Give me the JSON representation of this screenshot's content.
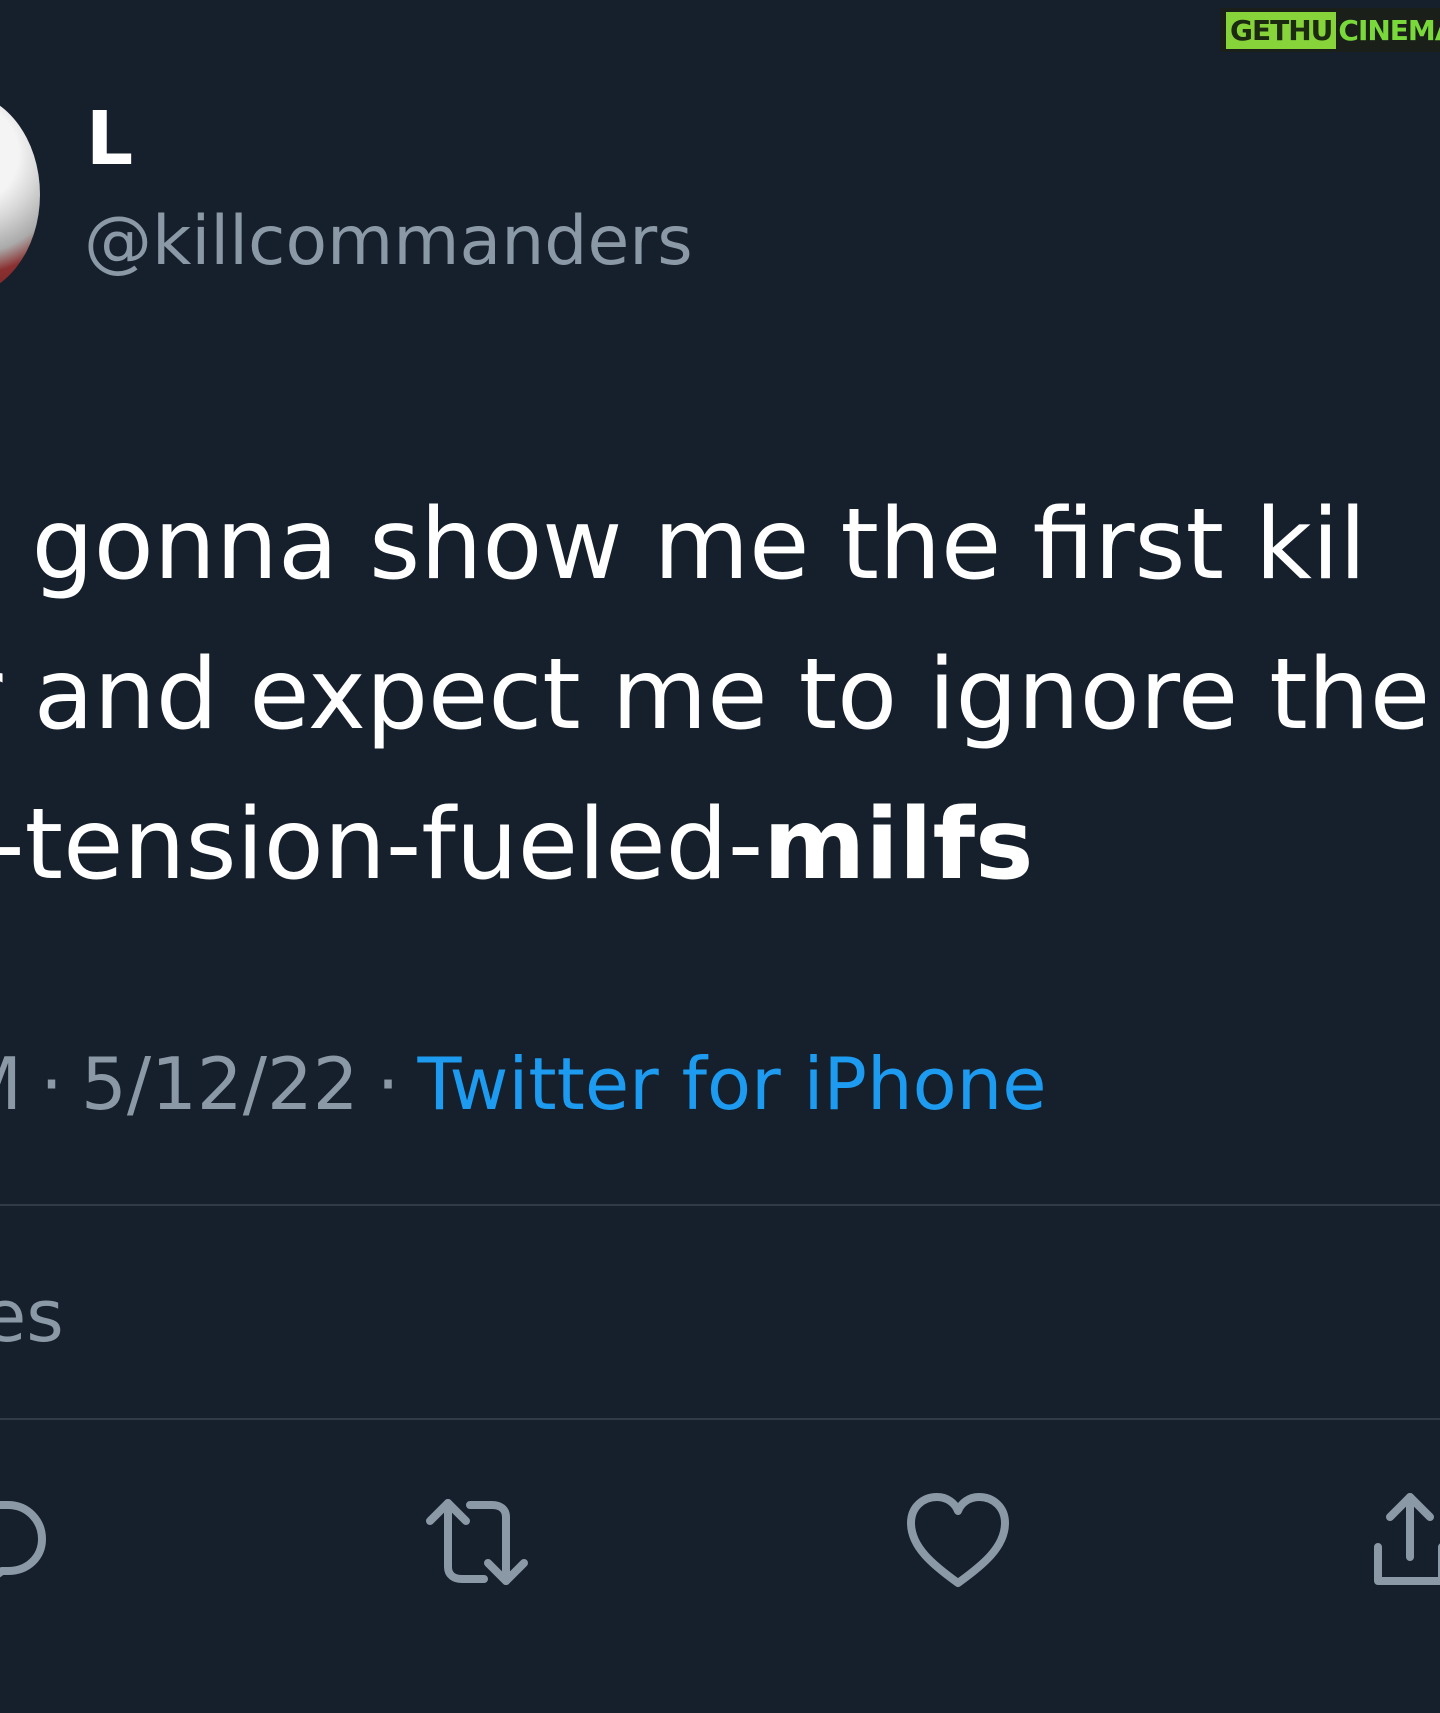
{
  "watermark": {
    "part1": "GETHU",
    "part2": "CINEMA"
  },
  "user": {
    "display_name": "L",
    "handle": "@killcommanders"
  },
  "tweet": {
    "lines": [
      "re gonna show me the first kil",
      "er and expect me to ignore the"
    ],
    "last_line_regular": "al-tension-fueled-",
    "last_line_bold": "milfs"
  },
  "meta": {
    "time_fragment": "M",
    "date": "5/12/22",
    "separator": "·",
    "source": "Twitter for iPhone"
  },
  "stats": {
    "fragment": "es"
  },
  "actions": [
    {
      "name": "reply",
      "icon": "reply-icon"
    },
    {
      "name": "retweet",
      "icon": "retweet-icon"
    },
    {
      "name": "like",
      "icon": "heart-icon"
    },
    {
      "name": "share",
      "icon": "share-icon"
    }
  ],
  "colors": {
    "background": "#16202c",
    "primary_text": "#ffffff",
    "secondary_text": "#8b98a5",
    "link": "#1d9bf0",
    "divider": "#2f3b47"
  }
}
